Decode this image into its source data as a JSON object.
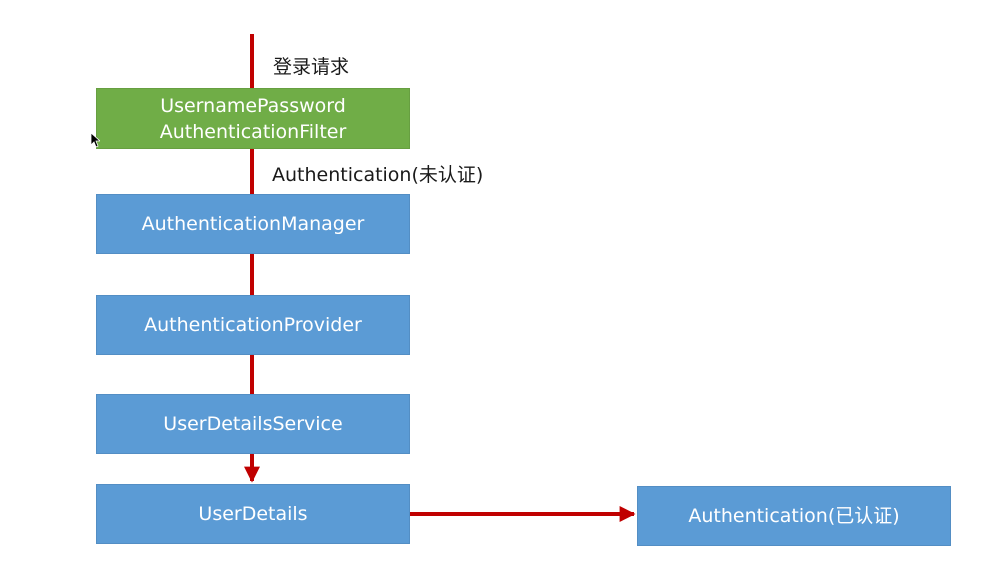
{
  "colors": {
    "box_blue": "#5b9bd5",
    "box_green": "#70ad47",
    "arrow_red": "#c00000",
    "title_red": "#e03c3c"
  },
  "title_partial": "",
  "labels": {
    "login_request": "登录请求",
    "auth_unauthenticated": "Authentication(未认证)"
  },
  "boxes": {
    "filter_line1": "UsernamePassword",
    "filter_line2": "AuthenticationFilter",
    "manager": "AuthenticationManager",
    "provider": "AuthenticationProvider",
    "user_details_service": "UserDetailsService",
    "user_details": "UserDetails",
    "auth_authenticated": "Authentication(已认证)"
  },
  "icons": {
    "cursor": "cursor-icon"
  }
}
